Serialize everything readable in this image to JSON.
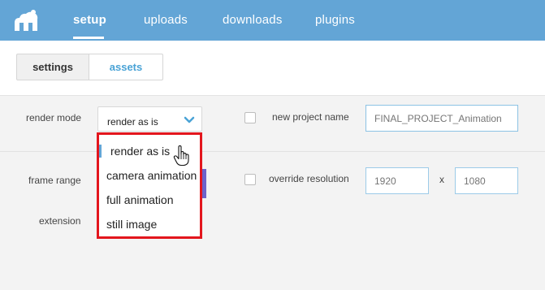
{
  "nav": {
    "items": [
      {
        "label": "setup"
      },
      {
        "label": "uploads"
      },
      {
        "label": "downloads"
      },
      {
        "label": "plugins"
      }
    ]
  },
  "tabs": [
    {
      "label": "settings"
    },
    {
      "label": "assets"
    }
  ],
  "form": {
    "render_mode_label": "render mode",
    "render_mode_value": "render as is",
    "new_project_name_label": "new project name",
    "new_project_name_placeholder": "FINAL_PROJECT_Animation",
    "frame_range_label": "frame range",
    "override_resolution_label": "override resolution",
    "width_placeholder": "1920",
    "height_placeholder": "1080",
    "times_symbol": "x",
    "extension_label": "extension"
  },
  "dropdown": {
    "options": [
      {
        "label": "render as is"
      },
      {
        "label": "camera animation"
      },
      {
        "label": "full animation"
      },
      {
        "label": "still image"
      }
    ]
  },
  "colors": {
    "topbar": "#63a5d6",
    "accent": "#4aa3d6",
    "highlight_border": "#e3161d"
  },
  "icons": {
    "logo": "cloud-logo-icon",
    "chevron": "chevron-down-icon",
    "cursor": "hand-pointer-icon"
  }
}
